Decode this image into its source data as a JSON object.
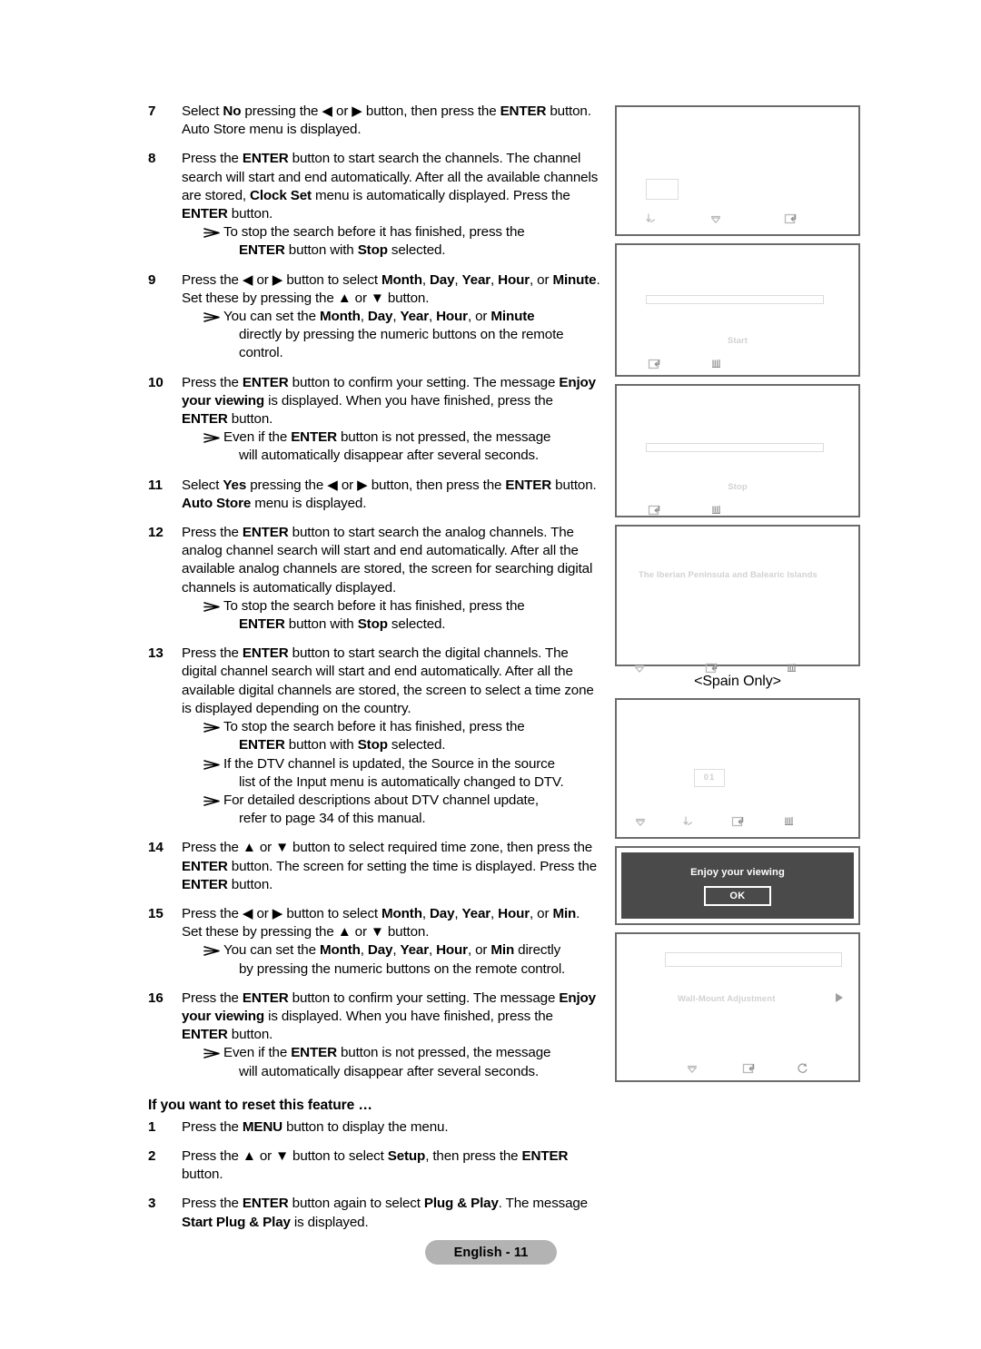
{
  "page": {
    "footer_label": "English - 11",
    "spain_only_caption": "<Spain Only>"
  },
  "instructions": {
    "steps": [
      {
        "num": "7",
        "body_html": "Select <b>No</b> pressing the ◀ or ▶ button, then press the <b>ENTER</b> button. Auto Store menu is displayed.",
        "notes": []
      },
      {
        "num": "8",
        "body_html": "Press the <b>ENTER</b> button to start search the channels. The channel search will start and end automatically. After all the available channels are stored, <b>Clock Set</b> menu is automatically displayed. Press the <b>ENTER</b> button.",
        "notes": [
          "To stop the search before it has finished, press the <span class=\"cont\"><b>ENTER</b> button with <b>Stop</b> selected.</span>"
        ]
      },
      {
        "num": "9",
        "body_html": "Press the ◀ or ▶ button to select <b>Month</b>, <b>Day</b>, <b>Year</b>, <b>Hour</b>, or <b>Minute</b>. Set these by pressing the ▲ or ▼ button.",
        "notes": [
          "You can set the <b>Month</b>, <b>Day</b>, <b>Year</b>, <b>Hour</b>, or <b>Minute</b> <span class=\"cont\">directly by pressing the numeric buttons on the remote</span><span class=\"cont\">control.</span>"
        ]
      },
      {
        "num": "10",
        "body_html": "Press the <b>ENTER</b> button to confirm your setting. The message <b>Enjoy your viewing</b> is displayed. When you have finished, press the <b>ENTER</b> button.",
        "notes": [
          "Even if the <b>ENTER</b> button is not pressed, the message <span class=\"cont\">will automatically disappear after several seconds.</span>"
        ]
      },
      {
        "num": "11",
        "body_html": "Select <b>Yes</b> pressing the ◀ or ▶ button, then press the <b>ENTER</b> button. <b>Auto Store</b> menu is displayed.",
        "notes": []
      },
      {
        "num": "12",
        "body_html": "Press the <b>ENTER</b> button to start search the analog channels. The analog channel search will start and end automatically. After all the available analog channels are stored, the screen for searching digital channels is automatically displayed.",
        "notes": [
          "To stop the search before it has finished, press the <span class=\"cont\"><b>ENTER</b> button with <b>Stop</b> selected.</span>"
        ]
      },
      {
        "num": "13",
        "body_html": "Press the <b>ENTER</b> button to start search the digital channels. The digital channel search will start and end automatically. After all the available digital channels are stored, the screen to select a time zone is displayed depending on the country.",
        "notes": [
          "To stop the search before it has finished, press the <span class=\"cont\"><b>ENTER</b> button with <b>Stop</b> selected.</span>",
          "If the DTV channel is updated, the Source in the source <span class=\"cont\">list of the Input menu is automatically changed to DTV.</span>",
          "For detailed descriptions about DTV channel update, <span class=\"cont\">refer to page 34 of this manual.</span>"
        ]
      },
      {
        "num": "14",
        "body_html": "Press the ▲ or ▼ button to select required time zone, then press the <b>ENTER</b> button. The screen for setting the time is displayed. Press the <b>ENTER</b> button.",
        "notes": []
      },
      {
        "num": "15",
        "body_html": "Press the ◀ or ▶ button to select <b>Month</b>, <b>Day</b>, <b>Year</b>, <b>Hour</b>, or <b>Min</b>. Set these by pressing the ▲ or ▼ button.",
        "notes": [
          "You can set the <b>Month</b>, <b>Day</b>, <b>Year</b>, <b>Hour</b>, or <b>Min</b> directly <span class=\"cont\">by pressing the numeric buttons on the remote control.</span>"
        ]
      },
      {
        "num": "16",
        "body_html": "Press the <b>ENTER</b> button to confirm your setting. The message <b>Enjoy your viewing</b> is displayed. When you have finished, press the <b>ENTER</b> button.",
        "notes": [
          "Even if the <b>ENTER</b> button is not pressed, the message <span class=\"cont\">will automatically disappear after several seconds.</span>"
        ]
      }
    ],
    "reset_heading": "If you want to reset this feature …",
    "reset_steps": [
      {
        "num": "1",
        "body_html": "Press the <b>MENU</b> button to display the menu.",
        "notes": []
      },
      {
        "num": "2",
        "body_html": "Press the ▲ or ▼ button to select <b>Setup</b>, then press the <b>ENTER</b> button.",
        "notes": []
      },
      {
        "num": "3",
        "body_html": "Press the <b>ENTER</b> button again to select <b>Plug &amp; Play</b>. The message <b>Start Plug &amp; Play</b> is displayed.",
        "notes": []
      }
    ]
  },
  "screens": [
    {
      "name": "country-select-screen",
      "labels": [],
      "chip": "",
      "icons": [
        "adjust-icon",
        "move-down-icon",
        "enter-icon"
      ]
    },
    {
      "name": "auto-store-start-screen",
      "labels": [
        "Start"
      ],
      "icons": [
        "enter-icon",
        "exit-icon"
      ]
    },
    {
      "name": "auto-store-stop-screen",
      "labels": [
        "Stop"
      ],
      "icons": [
        "enter-icon",
        "exit-icon"
      ]
    },
    {
      "name": "time-zone-screen",
      "labels": [
        "The Iberian Peninsula and Balearic Islands"
      ],
      "icons": [
        "move-down-icon",
        "enter-icon",
        "exit-icon"
      ]
    },
    {
      "name": "clock-set-screen",
      "chip": "01",
      "icons": [
        "move-down-icon",
        "adjust-icon",
        "enter-icon",
        "exit-icon"
      ]
    },
    {
      "name": "enjoy-your-viewing-dialog",
      "message": "Enjoy your viewing",
      "ok_label": "OK"
    },
    {
      "name": "setup-menu-screen",
      "labels": [
        "Wall-Mount Adjustment"
      ],
      "icons": [
        "move-down-icon",
        "enter-icon",
        "return-icon"
      ]
    }
  ]
}
